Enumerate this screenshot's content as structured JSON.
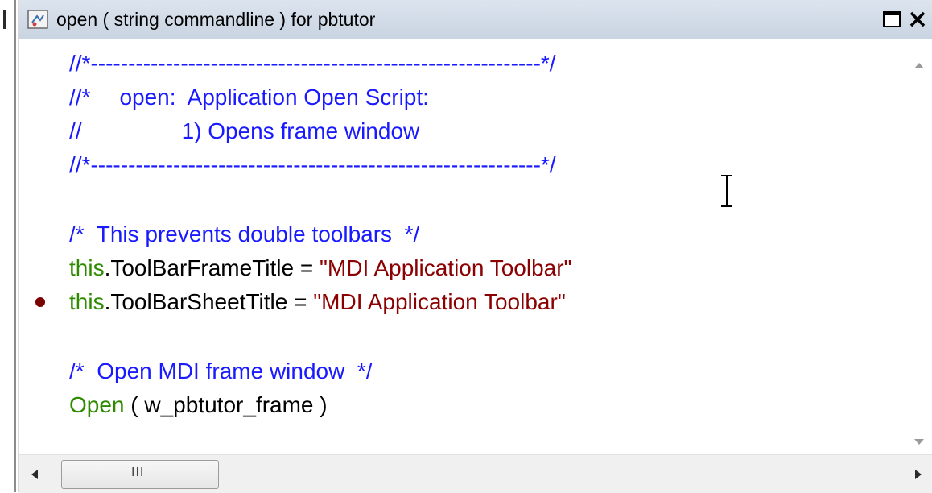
{
  "window": {
    "title": "open ( string commandline ) for pbtutor",
    "buttons": {
      "maximize": "maximize-icon",
      "close": "close-icon"
    }
  },
  "colors": {
    "comment": "#1a1aff",
    "keyword": "#2e8b00",
    "plain": "#000000",
    "string": "#8b0000",
    "breakpoint": "#7a0000"
  },
  "code": {
    "line1": "//*------------------------------------------------------------*/",
    "line2a": "//*",
    "line2b": "open:  Application Open Script:",
    "line3a": "//",
    "line3b": "1) Opens frame window",
    "line4": "//*------------------------------------------------------------*/",
    "line6": "/*  This prevents double toolbars  */",
    "line7": {
      "kw": "this",
      "plain": ".ToolBarFrameTitle = ",
      "str": "\"MDI Application Toolbar\""
    },
    "line8": {
      "kw": "this",
      "plain": ".ToolBarSheetTitle = ",
      "str": "\"MDI Application Toolbar\""
    },
    "line10": "/*  Open MDI frame window  */",
    "line11": {
      "kw": "Open",
      "plain": " ( w_pbtutor_frame )"
    }
  },
  "scrollbar": {
    "grip": "III"
  }
}
